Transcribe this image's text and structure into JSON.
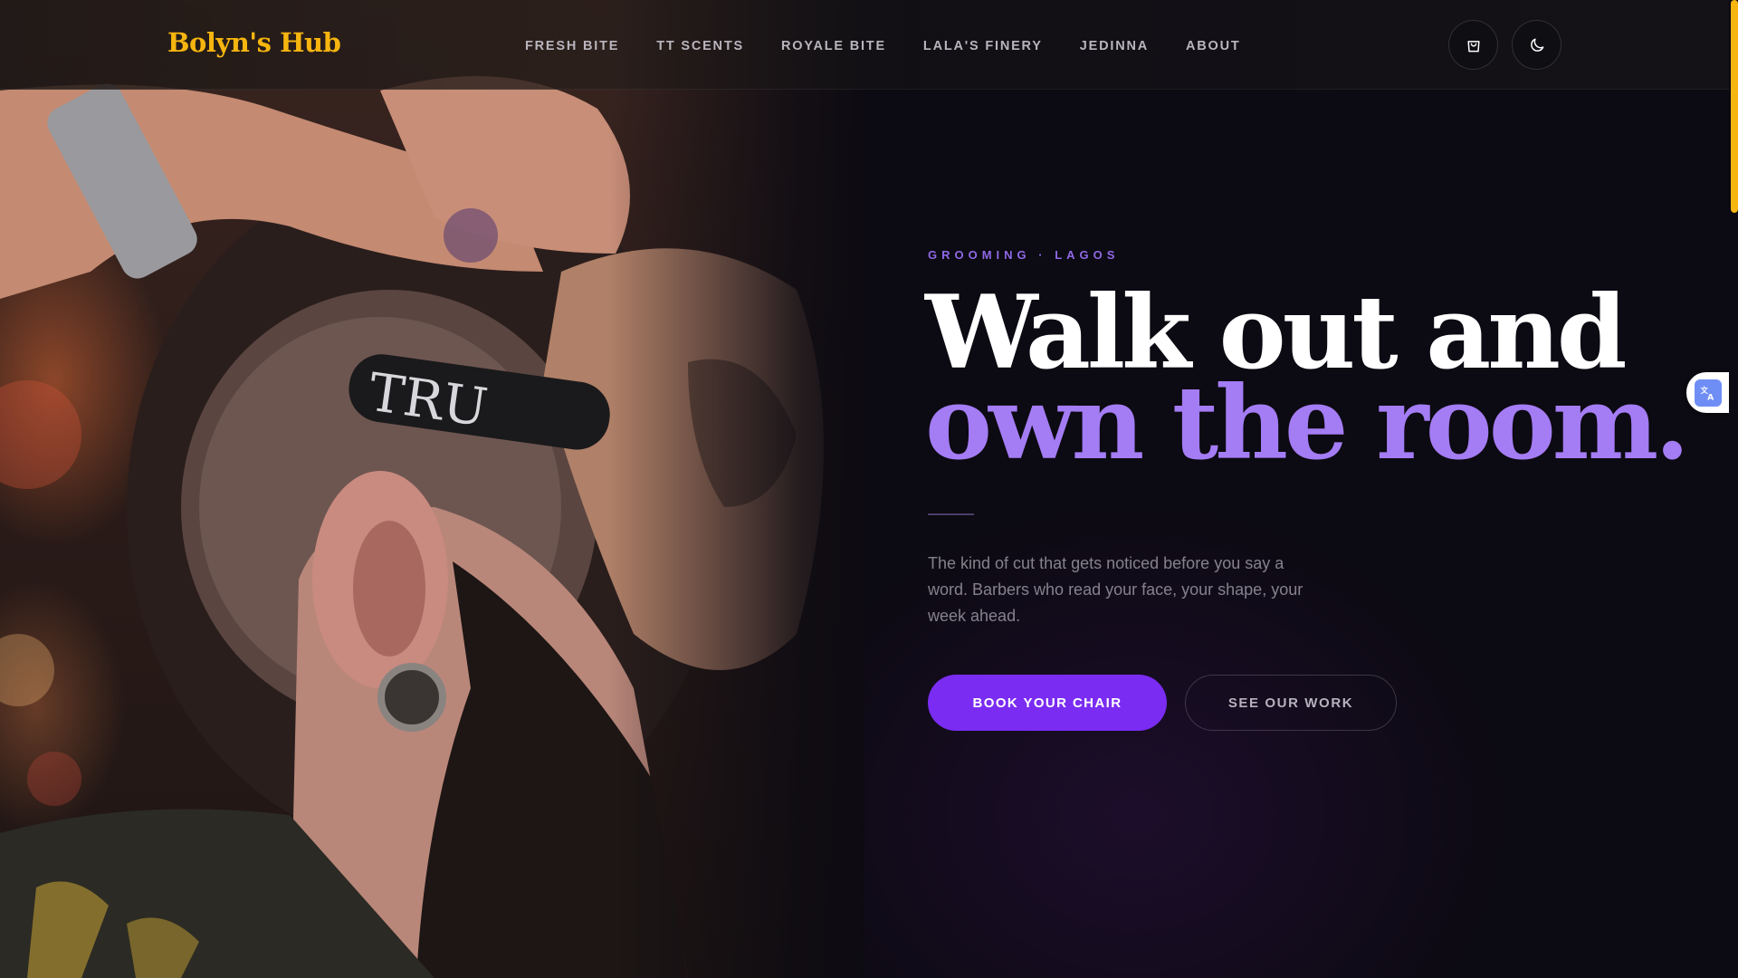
{
  "header": {
    "logo": "Bolyn's Hub",
    "nav": [
      {
        "label": "FRESH BITE"
      },
      {
        "label": "TT SCENTS"
      },
      {
        "label": "ROYALE BITE"
      },
      {
        "label": "LALA'S FINERY"
      },
      {
        "label": "JEDINNA"
      },
      {
        "label": "ABOUT"
      }
    ],
    "icons": {
      "cart": "shopping-bag-icon",
      "theme": "moon-icon"
    }
  },
  "hero": {
    "eyebrow": "GROOMING · LAGOS",
    "headline_line1": "Walk out and",
    "headline_line2": "own the room.",
    "lead": "The kind of cut that gets noticed before you say a word. Barbers who read your face, your shape, your week ahead.",
    "primary_cta": "BOOK YOUR CHAIR",
    "secondary_cta": "SEE OUR WORK",
    "photo_text": "TRU"
  },
  "widgets": {
    "translate_icon": "translate-icon"
  },
  "colors": {
    "brand": "#f6b50f",
    "accent": "#7a2cf2",
    "accent_light": "#a47cf4",
    "background": "#0c0a12"
  }
}
